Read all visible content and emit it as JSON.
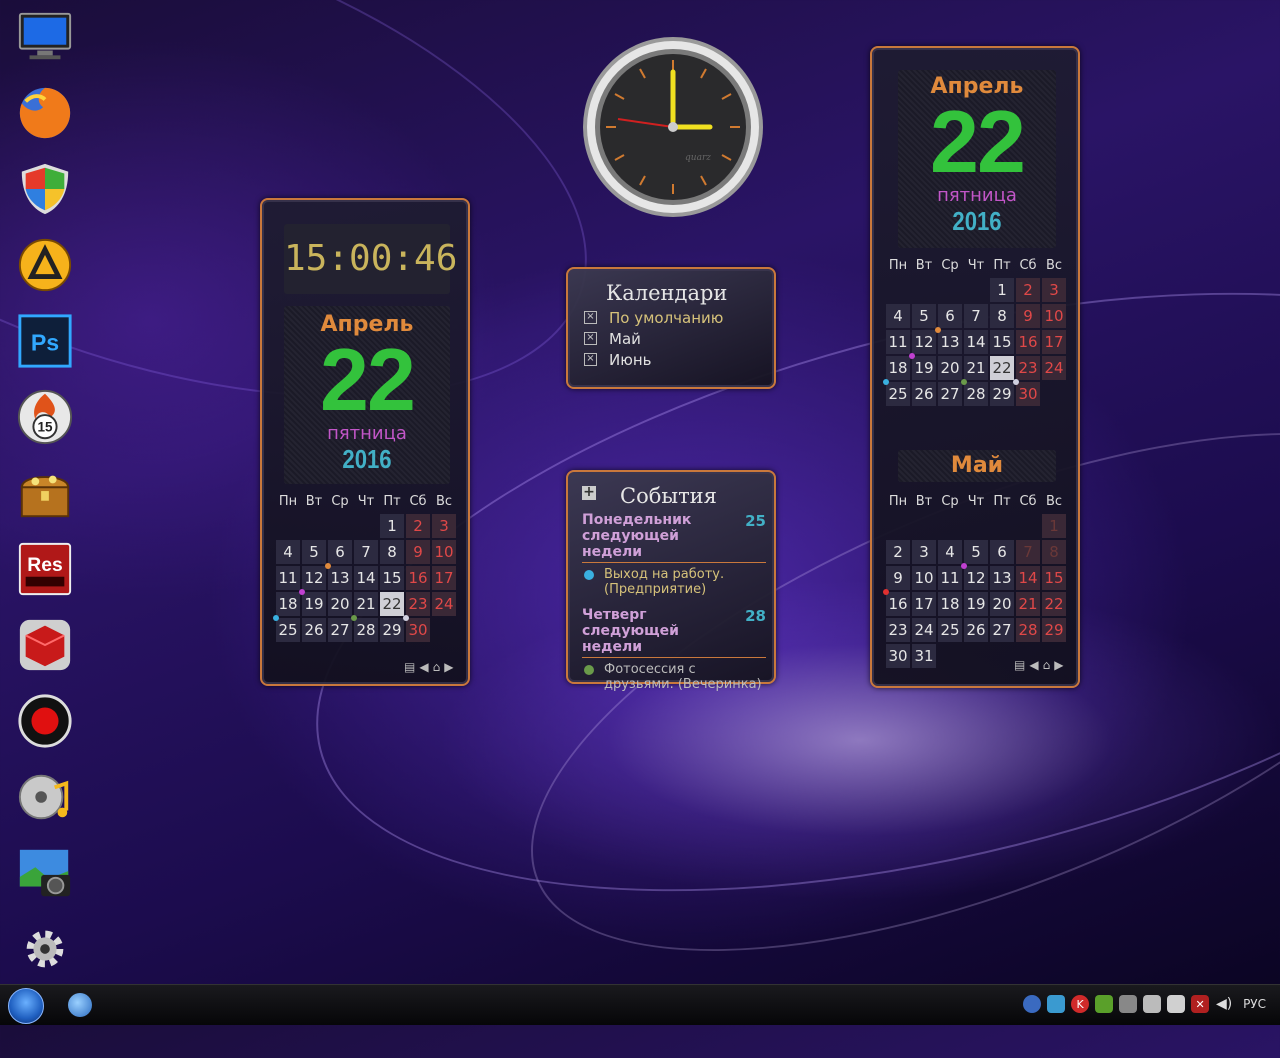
{
  "desktop_icons": [
    {
      "name": "computer-icon"
    },
    {
      "name": "firefox-icon"
    },
    {
      "name": "security-shield-icon"
    },
    {
      "name": "aimp-icon"
    },
    {
      "name": "photoshop-icon",
      "label": "Ps"
    },
    {
      "name": "app-15-icon",
      "label": "15"
    },
    {
      "name": "treasure-chest-icon"
    },
    {
      "name": "resource-hacker-icon",
      "label": "Res"
    },
    {
      "name": "red-cube-icon"
    },
    {
      "name": "record-icon"
    },
    {
      "name": "media-player-icon"
    },
    {
      "name": "camera-photo-icon"
    },
    {
      "name": "settings-gear-icon"
    }
  ],
  "clock": {
    "brand": "quarz"
  },
  "left_calendar": {
    "time": "15:00:46",
    "month": "Апрель",
    "day": "22",
    "weekday": "пятница",
    "year": "2016",
    "headers": [
      "Пн",
      "Вт",
      "Ср",
      "Чт",
      "Пт",
      "Сб",
      "Вс"
    ],
    "weeks": [
      [
        "",
        "",
        "",
        "",
        "1",
        "2",
        "3"
      ],
      [
        "4",
        "5",
        "6",
        "7",
        "8",
        "9",
        "10"
      ],
      [
        "11",
        "12",
        "13",
        "14",
        "15",
        "16",
        "17"
      ],
      [
        "18",
        "19",
        "20",
        "21",
        "22",
        "23",
        "24"
      ],
      [
        "25",
        "26",
        "27",
        "28",
        "29",
        "30",
        ""
      ]
    ]
  },
  "calendars_gadget": {
    "title": "Календари",
    "items": [
      "По умолчанию",
      "Май",
      "Июнь"
    ]
  },
  "events_gadget": {
    "title": "События",
    "events": [
      {
        "heading": "Понедельник следующей недели",
        "day": "25",
        "text": "Выход на работу. (Предприятие)",
        "color": "#3ab0e0"
      },
      {
        "heading": "Четверг следующей недели",
        "day": "28",
        "text": "Фотосессия с друзьями. (Вечеринка)",
        "color": "#6a9a4a"
      }
    ]
  },
  "right_calendar": {
    "month": "Апрель",
    "day": "22",
    "weekday": "пятница",
    "year": "2016",
    "headers": [
      "Пн",
      "Вт",
      "Ср",
      "Чт",
      "Пт",
      "Сб",
      "Вс"
    ],
    "weeks": [
      [
        "",
        "",
        "",
        "",
        "1",
        "2",
        "3"
      ],
      [
        "4",
        "5",
        "6",
        "7",
        "8",
        "9",
        "10"
      ],
      [
        "11",
        "12",
        "13",
        "14",
        "15",
        "16",
        "17"
      ],
      [
        "18",
        "19",
        "20",
        "21",
        "22",
        "23",
        "24"
      ],
      [
        "25",
        "26",
        "27",
        "28",
        "29",
        "30",
        ""
      ]
    ],
    "next_month": "Май",
    "next_headers": [
      "Пн",
      "Вт",
      "Ср",
      "Чт",
      "Пт",
      "Сб",
      "Вс"
    ],
    "next_weeks": [
      [
        "",
        "",
        "",
        "",
        "",
        "",
        "1"
      ],
      [
        "2",
        "3",
        "4",
        "5",
        "6",
        "7",
        "8"
      ],
      [
        "9",
        "10",
        "11",
        "12",
        "13",
        "14",
        "15"
      ],
      [
        "16",
        "17",
        "18",
        "19",
        "20",
        "21",
        "22"
      ],
      [
        "23",
        "24",
        "25",
        "26",
        "27",
        "28",
        "29"
      ],
      [
        "30",
        "31",
        "",
        "",
        "",
        "",
        ""
      ]
    ]
  },
  "taskbar": {
    "language": "РУС"
  }
}
